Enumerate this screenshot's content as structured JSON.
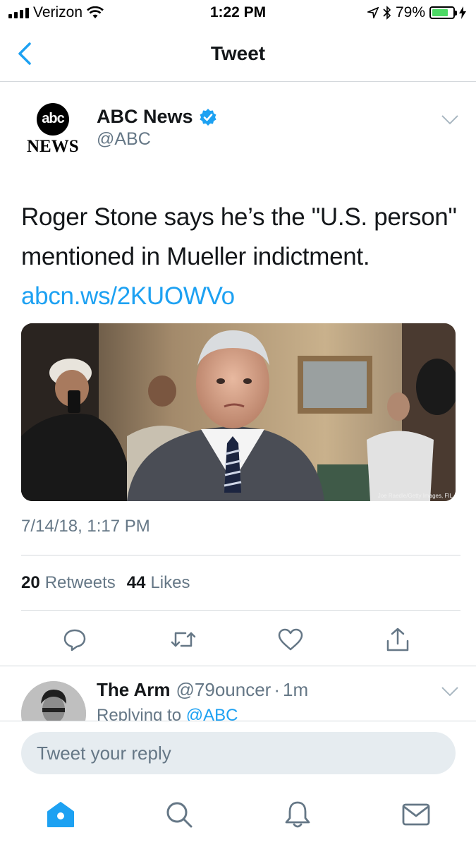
{
  "status_bar": {
    "carrier": "Verizon",
    "time": "1:22 PM",
    "battery_percent": "79%",
    "battery_level": 0.79,
    "battery_color": "#4cd964"
  },
  "nav": {
    "back_icon": "chevron-left-icon",
    "title": "Tweet"
  },
  "tweet": {
    "author": {
      "logo_text": "abc",
      "logo_subtext": "NEWS",
      "name": "ABC News",
      "handle": "@ABC",
      "verified": true
    },
    "text": "Roger Stone says he’s the \"U.S. person\" mentioned in Mueller indictment.",
    "link": "abcn.ws/2KUOWVo",
    "media_credit": "Joe Raedle/Getty Images, FIL",
    "timestamp": "7/14/18, 1:17 PM",
    "stats": {
      "retweets_count": "20",
      "retweets_label": "Retweets",
      "likes_count": "44",
      "likes_label": "Likes"
    },
    "actions": [
      "reply-icon",
      "retweet-icon",
      "like-icon",
      "share-icon"
    ]
  },
  "reply": {
    "name": "The Arm",
    "handle": "@79ouncer",
    "separator": "·",
    "time": "1m",
    "replying_prefix": "Replying to",
    "replying_to": "@ABC"
  },
  "compose": {
    "placeholder": "Tweet your reply"
  },
  "tab_bar": {
    "tabs": [
      "home-icon",
      "search-icon",
      "notifications-icon",
      "messages-icon"
    ],
    "active": "home-icon"
  },
  "colors": {
    "accent": "#1da1f2",
    "text": "#14171a",
    "secondary": "#657786",
    "divider": "#d4d8dc",
    "reply_box": "#e6ecf0"
  }
}
